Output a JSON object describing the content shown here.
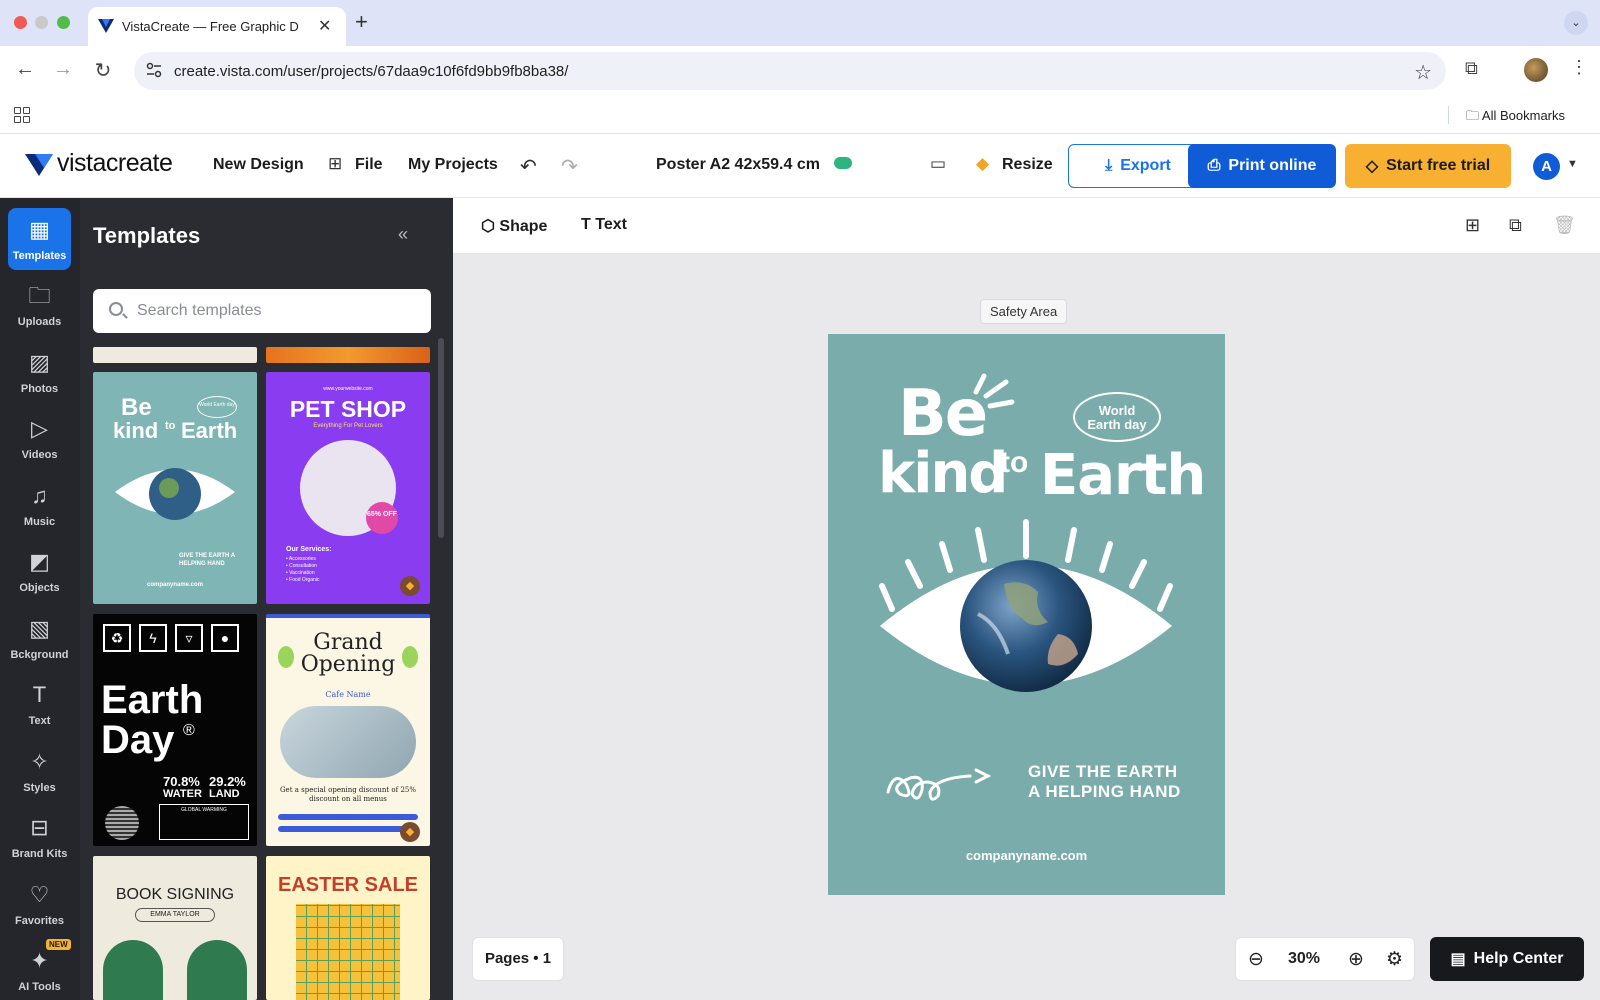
{
  "browser": {
    "tab_title": "VistaCreate — Free Graphic D",
    "url": "create.vista.com/user/projects/67daa9c10f6fd9bb9fb8ba38/",
    "bookmarks_label": "All Bookmarks"
  },
  "header": {
    "logo_text": "vistacreate",
    "new_design": "New Design",
    "file": "File",
    "my_projects": "My Projects",
    "doc_title": "Poster A2 42x59.4 cm",
    "resize": "Resize",
    "export": "Export",
    "print_online": "Print online",
    "start_trial": "Start free trial",
    "avatar_initial": "A"
  },
  "rail": {
    "items": [
      {
        "label": "Templates"
      },
      {
        "label": "Uploads"
      },
      {
        "label": "Photos"
      },
      {
        "label": "Videos"
      },
      {
        "label": "Music"
      },
      {
        "label": "Objects"
      },
      {
        "label": "Bckground"
      },
      {
        "label": "Text"
      },
      {
        "label": "Styles"
      },
      {
        "label": "Brand Kits"
      },
      {
        "label": "Favorites"
      },
      {
        "label": "AI Tools"
      }
    ],
    "new_badge": "NEW"
  },
  "panel": {
    "title": "Templates",
    "search_placeholder": "Search templates",
    "templates": {
      "earth": {
        "be": "Be",
        "kind": "kind",
        "to": "to",
        "earth": "Earth",
        "badge": "World Earth day",
        "give": "GIVE THE EARTH A HELPING HAND",
        "url": "companyname.com"
      },
      "pet": {
        "site": "www.yourwebsite.com",
        "title": "PET SHOP",
        "subtitle": "Everything For Pet Lovers",
        "discount": "65% OFF",
        "services_title": "Our Services:",
        "services": [
          "• Accessories",
          "• Consultation",
          "• Vaccination",
          "• Food Organic"
        ]
      },
      "day": {
        "title1": "Earth",
        "title2": "Day",
        "reg": "®",
        "stat1": "70.8%",
        "stat1_label": "WATER",
        "stat2": "29.2%",
        "stat2_label": "LAND",
        "warning": "GLOBAL WARMING"
      },
      "grand": {
        "title1": "Grand",
        "title2": "Opening",
        "cafe": "Cafe Name",
        "offer": "Get a special opening discount of 25% discount on all menus"
      },
      "book": {
        "title": "BOOK SIGNING",
        "name": "EMMA TAYLOR"
      },
      "easter": {
        "title": "EASTER SALE"
      }
    }
  },
  "toolbar": {
    "shape": "Shape",
    "text": "Text"
  },
  "canvas": {
    "safety_area": "Safety Area",
    "poster": {
      "be": "Be",
      "kind": "kind",
      "to": "to",
      "earth": "Earth",
      "badge_line1": "World",
      "badge_line2": "Earth day",
      "give_line1": "GIVE THE EARTH",
      "give_line2": "A HELPING HAND",
      "url": "companyname.com"
    },
    "background_color": "#79acab"
  },
  "footer": {
    "pages": "Pages • 1",
    "zoom": "30%",
    "help": "Help Center"
  },
  "colors": {
    "primary": "#1a73e8",
    "print_button": "#0f5cd6",
    "trial_button": "#f7b032",
    "rail_bg": "#24262b",
    "panel_bg": "#2a2c32"
  }
}
